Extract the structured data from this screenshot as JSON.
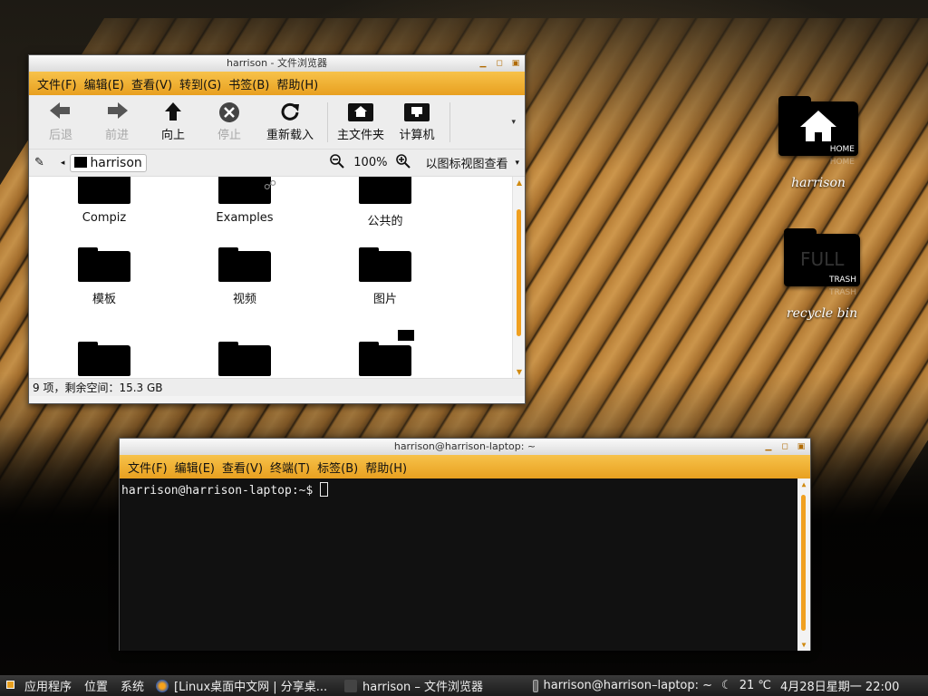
{
  "desktop": {
    "icons": [
      {
        "label": "harrison",
        "caption": "HOME",
        "reflection": "HOME"
      },
      {
        "label": "recycle bin",
        "caption": "TRASH",
        "reflection": "TRASH",
        "overlay": "FULL"
      }
    ]
  },
  "file_browser": {
    "title": "harrison - 文件浏览器",
    "menus": [
      "文件(F)",
      "编辑(E)",
      "查看(V)",
      "转到(G)",
      "书签(B)",
      "帮助(H)"
    ],
    "toolbar": {
      "back": "后退",
      "forward": "前进",
      "up": "向上",
      "stop": "停止",
      "reload": "重新载入",
      "home": "主文件夹",
      "computer": "计算机"
    },
    "location": {
      "crumb": "harrison",
      "zoom": "100%",
      "view_mode": "以图标视图查看"
    },
    "items": [
      "Compiz",
      "Examples",
      "公共的",
      "模板",
      "视频",
      "图片",
      "",
      "",
      ""
    ],
    "status": "9 项，剩余空间：15.3 GB"
  },
  "terminal": {
    "title": "harrison@harrison-laptop: ~",
    "menus": [
      "文件(F)",
      "编辑(E)",
      "查看(V)",
      "终端(T)",
      "标签(B)",
      "帮助(H)"
    ],
    "prompt": "harrison@harrison-laptop:~$ "
  },
  "panel": {
    "applications": "应用程序",
    "places": "位置",
    "system": "系统",
    "tasks": [
      "[Linux桌面中文网 | 分享桌...",
      "harrison – 文件浏览器",
      "harrison@harrison–laptop: ~"
    ],
    "weather": "21 ℃",
    "clock": "4月28日星期一 22:00"
  },
  "colors": {
    "accent": "#f0a020",
    "menubar": "#f3b53a"
  }
}
